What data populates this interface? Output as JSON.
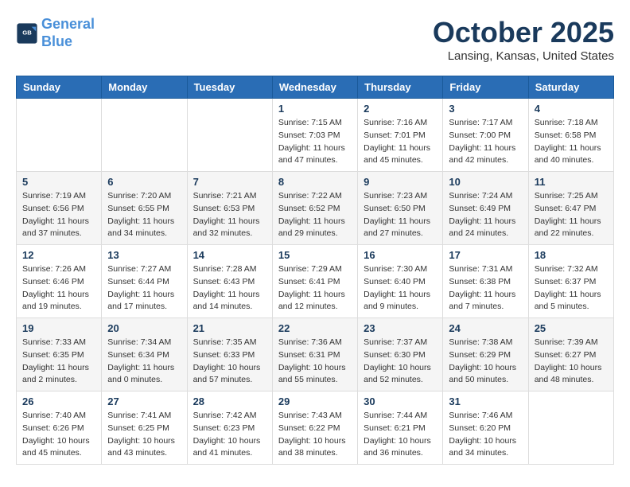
{
  "logo": {
    "line1": "General",
    "line2": "Blue"
  },
  "title": "October 2025",
  "location": "Lansing, Kansas, United States",
  "weekdays": [
    "Sunday",
    "Monday",
    "Tuesday",
    "Wednesday",
    "Thursday",
    "Friday",
    "Saturday"
  ],
  "weeks": [
    [
      {
        "day": "",
        "info": ""
      },
      {
        "day": "",
        "info": ""
      },
      {
        "day": "",
        "info": ""
      },
      {
        "day": "1",
        "info": "Sunrise: 7:15 AM\nSunset: 7:03 PM\nDaylight: 11 hours\nand 47 minutes."
      },
      {
        "day": "2",
        "info": "Sunrise: 7:16 AM\nSunset: 7:01 PM\nDaylight: 11 hours\nand 45 minutes."
      },
      {
        "day": "3",
        "info": "Sunrise: 7:17 AM\nSunset: 7:00 PM\nDaylight: 11 hours\nand 42 minutes."
      },
      {
        "day": "4",
        "info": "Sunrise: 7:18 AM\nSunset: 6:58 PM\nDaylight: 11 hours\nand 40 minutes."
      }
    ],
    [
      {
        "day": "5",
        "info": "Sunrise: 7:19 AM\nSunset: 6:56 PM\nDaylight: 11 hours\nand 37 minutes."
      },
      {
        "day": "6",
        "info": "Sunrise: 7:20 AM\nSunset: 6:55 PM\nDaylight: 11 hours\nand 34 minutes."
      },
      {
        "day": "7",
        "info": "Sunrise: 7:21 AM\nSunset: 6:53 PM\nDaylight: 11 hours\nand 32 minutes."
      },
      {
        "day": "8",
        "info": "Sunrise: 7:22 AM\nSunset: 6:52 PM\nDaylight: 11 hours\nand 29 minutes."
      },
      {
        "day": "9",
        "info": "Sunrise: 7:23 AM\nSunset: 6:50 PM\nDaylight: 11 hours\nand 27 minutes."
      },
      {
        "day": "10",
        "info": "Sunrise: 7:24 AM\nSunset: 6:49 PM\nDaylight: 11 hours\nand 24 minutes."
      },
      {
        "day": "11",
        "info": "Sunrise: 7:25 AM\nSunset: 6:47 PM\nDaylight: 11 hours\nand 22 minutes."
      }
    ],
    [
      {
        "day": "12",
        "info": "Sunrise: 7:26 AM\nSunset: 6:46 PM\nDaylight: 11 hours\nand 19 minutes."
      },
      {
        "day": "13",
        "info": "Sunrise: 7:27 AM\nSunset: 6:44 PM\nDaylight: 11 hours\nand 17 minutes."
      },
      {
        "day": "14",
        "info": "Sunrise: 7:28 AM\nSunset: 6:43 PM\nDaylight: 11 hours\nand 14 minutes."
      },
      {
        "day": "15",
        "info": "Sunrise: 7:29 AM\nSunset: 6:41 PM\nDaylight: 11 hours\nand 12 minutes."
      },
      {
        "day": "16",
        "info": "Sunrise: 7:30 AM\nSunset: 6:40 PM\nDaylight: 11 hours\nand 9 minutes."
      },
      {
        "day": "17",
        "info": "Sunrise: 7:31 AM\nSunset: 6:38 PM\nDaylight: 11 hours\nand 7 minutes."
      },
      {
        "day": "18",
        "info": "Sunrise: 7:32 AM\nSunset: 6:37 PM\nDaylight: 11 hours\nand 5 minutes."
      }
    ],
    [
      {
        "day": "19",
        "info": "Sunrise: 7:33 AM\nSunset: 6:35 PM\nDaylight: 11 hours\nand 2 minutes."
      },
      {
        "day": "20",
        "info": "Sunrise: 7:34 AM\nSunset: 6:34 PM\nDaylight: 11 hours\nand 0 minutes."
      },
      {
        "day": "21",
        "info": "Sunrise: 7:35 AM\nSunset: 6:33 PM\nDaylight: 10 hours\nand 57 minutes."
      },
      {
        "day": "22",
        "info": "Sunrise: 7:36 AM\nSunset: 6:31 PM\nDaylight: 10 hours\nand 55 minutes."
      },
      {
        "day": "23",
        "info": "Sunrise: 7:37 AM\nSunset: 6:30 PM\nDaylight: 10 hours\nand 52 minutes."
      },
      {
        "day": "24",
        "info": "Sunrise: 7:38 AM\nSunset: 6:29 PM\nDaylight: 10 hours\nand 50 minutes."
      },
      {
        "day": "25",
        "info": "Sunrise: 7:39 AM\nSunset: 6:27 PM\nDaylight: 10 hours\nand 48 minutes."
      }
    ],
    [
      {
        "day": "26",
        "info": "Sunrise: 7:40 AM\nSunset: 6:26 PM\nDaylight: 10 hours\nand 45 minutes."
      },
      {
        "day": "27",
        "info": "Sunrise: 7:41 AM\nSunset: 6:25 PM\nDaylight: 10 hours\nand 43 minutes."
      },
      {
        "day": "28",
        "info": "Sunrise: 7:42 AM\nSunset: 6:23 PM\nDaylight: 10 hours\nand 41 minutes."
      },
      {
        "day": "29",
        "info": "Sunrise: 7:43 AM\nSunset: 6:22 PM\nDaylight: 10 hours\nand 38 minutes."
      },
      {
        "day": "30",
        "info": "Sunrise: 7:44 AM\nSunset: 6:21 PM\nDaylight: 10 hours\nand 36 minutes."
      },
      {
        "day": "31",
        "info": "Sunrise: 7:46 AM\nSunset: 6:20 PM\nDaylight: 10 hours\nand 34 minutes."
      },
      {
        "day": "",
        "info": ""
      }
    ]
  ]
}
